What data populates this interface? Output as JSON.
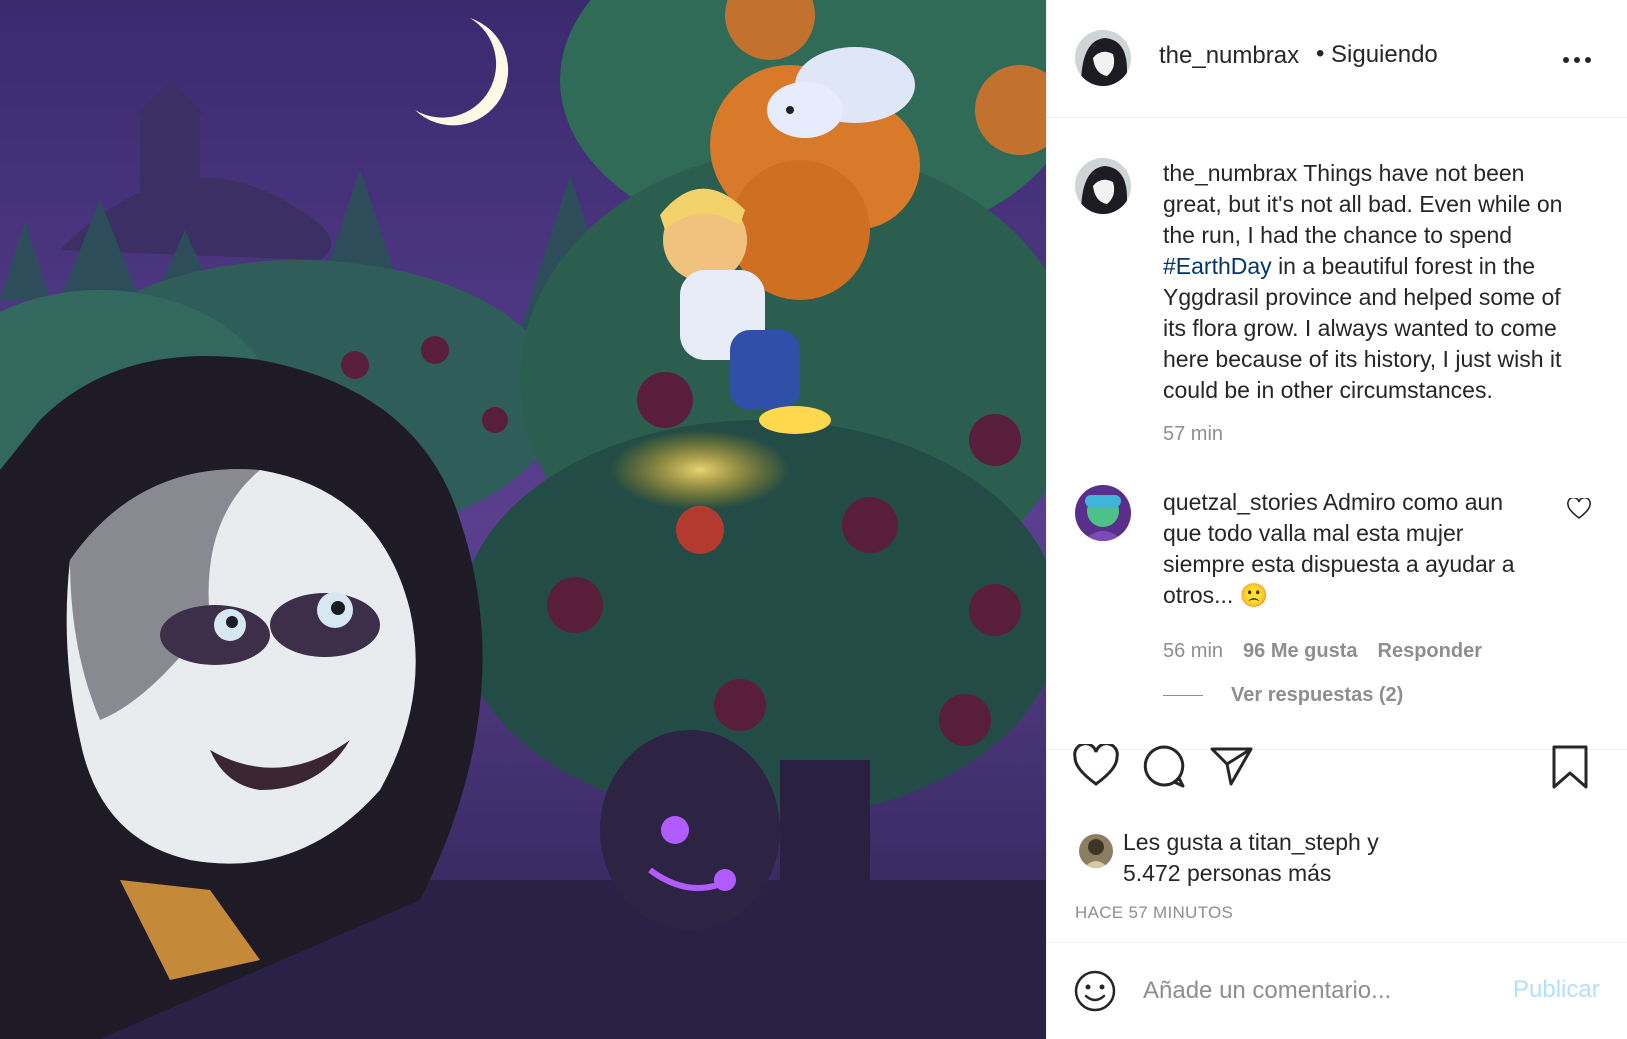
{
  "header": {
    "username": "the_numbrax",
    "separator": "•",
    "follow_status": "Siguiendo",
    "more_icon": "more-horizontal-icon"
  },
  "caption": {
    "username": "the_numbrax",
    "text_before": "Things have not been great, but it's not all bad. Even while on the run, I had the chance to spend",
    "hashtag": "#EarthDay",
    "text_after": "in a beautiful forest in the Yggdrasil province and helped some of its flora grow. I always wanted to come here because of its history, I just wish it could be in other circumstances.",
    "time": "57 min"
  },
  "comment": {
    "username": "quetzal_stories",
    "text": "Admiro como aun que todo valla mal esta mujer siempre esta dispuesta a ayudar a otros...",
    "emoji": "🙁",
    "time": "56 min",
    "likes": "96 Me gusta",
    "reply": "Responder",
    "view_replies": "Ver respuestas (2)"
  },
  "actions": {
    "like_icon": "heart-icon",
    "comment_icon": "comment-icon",
    "share_icon": "paper-plane-icon",
    "save_icon": "bookmark-icon"
  },
  "likes": {
    "prefix": "Les gusta a",
    "user": "titan_steph",
    "conj": "y",
    "others": "5.472 personas más"
  },
  "timestamp": "HACE 57 MINUTOS",
  "add_comment": {
    "placeholder": "Añade un comentario...",
    "publish": "Publicar",
    "emoji_icon": "smiley-icon"
  },
  "colors": {
    "hashtag": "#00376b",
    "publish_disabled": "#b2dffc",
    "muted": "#8e8e8e"
  }
}
